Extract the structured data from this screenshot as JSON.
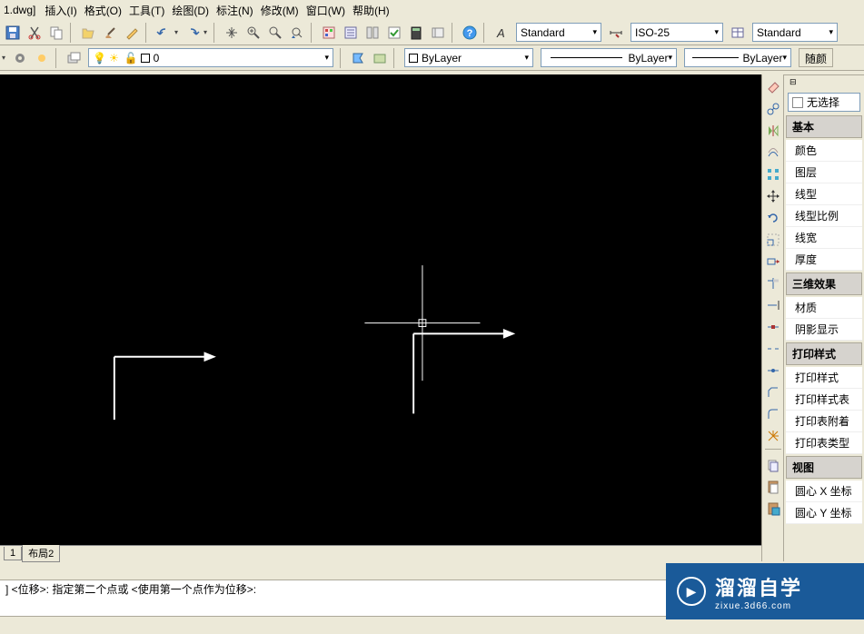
{
  "title_fragment": "1.dwg]",
  "menus": [
    "插入(I)",
    "格式(O)",
    "工具(T)",
    "绘图(D)",
    "标注(N)",
    "修改(M)",
    "窗口(W)",
    "帮助(H)"
  ],
  "top_combos": {
    "text_style": "Standard",
    "dim_style": "ISO-25",
    "table_style": "Standard"
  },
  "layer_row": {
    "layer_name": "0",
    "color_select": "ByLayer",
    "linetype_select": "ByLayer",
    "lineweight_select": "ByLayer",
    "end_button": "随颜"
  },
  "props": {
    "select": "无选择",
    "sections": [
      {
        "title": "基本",
        "rows": [
          "颜色",
          "图层",
          "线型",
          "线型比例",
          "线宽",
          "厚度"
        ]
      },
      {
        "title": "三维效果",
        "rows": [
          "材质",
          "阴影显示"
        ]
      },
      {
        "title": "打印样式",
        "rows": [
          "打印样式",
          "打印样式表",
          "打印表附着",
          "打印表类型"
        ]
      },
      {
        "title": "视图",
        "rows": [
          "圆心 X 坐标",
          "圆心 Y 坐标"
        ]
      }
    ]
  },
  "tabs": [
    "1",
    "布局2"
  ],
  "cmd_line1": "] <位移>:   指定第二个点或  <使用第一个点作为位移>:",
  "cmd_line2": "",
  "watermark": {
    "cn": "溜溜自学",
    "en": "zixue.3d66.com"
  }
}
